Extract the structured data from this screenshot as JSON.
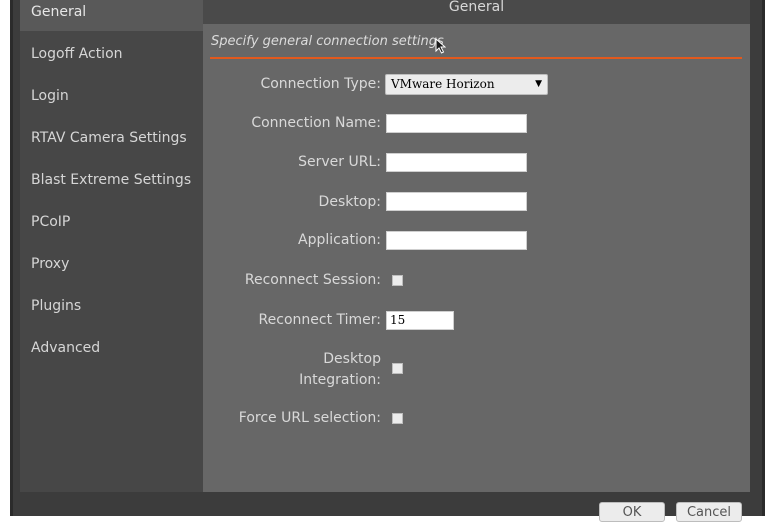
{
  "window": {
    "title": "General"
  },
  "sidebar": {
    "items": [
      {
        "label": "General"
      },
      {
        "label": "Logoff Action"
      },
      {
        "label": "Login"
      },
      {
        "label": "RTAV Camera Settings"
      },
      {
        "label": "Blast Extreme Settings"
      },
      {
        "label": "PCoIP"
      },
      {
        "label": "Proxy"
      },
      {
        "label": "Plugins"
      },
      {
        "label": "Advanced"
      }
    ]
  },
  "main": {
    "section_title": "Specify general connection settings",
    "fields": {
      "connection_type": {
        "label": "Connection Type:",
        "value": "VMware Horizon"
      },
      "connection_name": {
        "label": "Connection Name:",
        "value": ""
      },
      "server_url": {
        "label": "Server URL:",
        "value": ""
      },
      "desktop": {
        "label": "Desktop:",
        "value": ""
      },
      "application": {
        "label": "Application:",
        "value": ""
      },
      "reconnect_session": {
        "label": "Reconnect Session:",
        "checked": false
      },
      "reconnect_timer": {
        "label": "Reconnect Timer:",
        "value": "15"
      },
      "desktop_integration": {
        "label_line1": "Desktop",
        "label_line2": "Integration:",
        "checked": false
      },
      "force_url_selection": {
        "label": "Force URL selection:",
        "checked": false
      }
    }
  },
  "footer": {
    "ok_label": "OK",
    "cancel_label": "Cancel"
  },
  "colors": {
    "accent": "#e2591d",
    "sidebar_bg": "#474747",
    "panel_bg": "#676767"
  }
}
